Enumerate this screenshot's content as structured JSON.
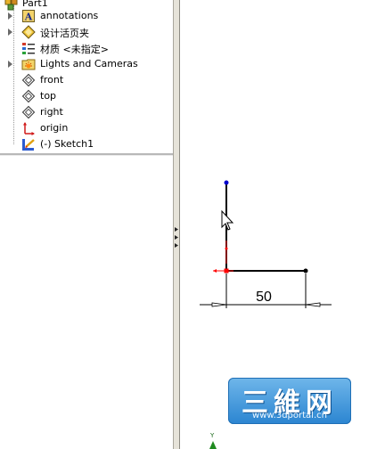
{
  "tree": {
    "items": [
      {
        "label": "Part1",
        "icon": "part-icon"
      },
      {
        "label": "annotations",
        "icon": "annotations-icon"
      },
      {
        "label": "设计活页夹",
        "icon": "design-binder-icon"
      },
      {
        "label": "材质 <未指定>",
        "icon": "material-icon"
      },
      {
        "label": "Lights and Cameras",
        "icon": "lights-cameras-icon"
      },
      {
        "label": "front",
        "icon": "plane-icon"
      },
      {
        "label": "top",
        "icon": "plane-icon"
      },
      {
        "label": "right",
        "icon": "plane-icon"
      },
      {
        "label": "origin",
        "icon": "origin-icon"
      },
      {
        "label": "(-) Sketch1",
        "icon": "sketch-icon"
      }
    ]
  },
  "sketch": {
    "dimension_text": "50"
  },
  "triad": {
    "y_label": "Y"
  },
  "watermark": {
    "text": "三維网",
    "url": "www.3dportal.cn"
  },
  "colors": {
    "sketch_line": "#000000",
    "relation": "#ff0000",
    "endpoint": "#0000cc",
    "watermark_blue": "#2b85d1"
  }
}
